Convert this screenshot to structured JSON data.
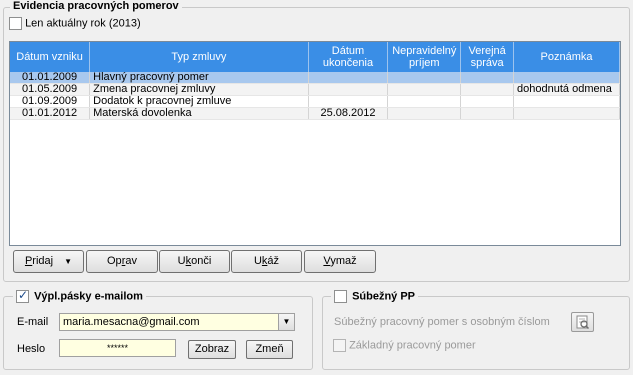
{
  "main_group": {
    "title": "Evidencia pracovných pomerov",
    "current_year_checkbox": {
      "label": "Len aktuálny rok (2013)",
      "checked": false
    }
  },
  "table": {
    "columns": [
      "Dátum vzniku",
      "Typ zmluvy",
      "Dátum ukončenia",
      "Nepravidelný príjem",
      "Verejná správa",
      "Poznámka"
    ],
    "rows": [
      [
        "01.01.2009",
        "Hlavný pracovný pomer",
        "",
        "",
        "",
        ""
      ],
      [
        "01.05.2009",
        "Zmena pracovnej zmluvy",
        "",
        "",
        "",
        "dohodnutá odmena"
      ],
      [
        "01.09.2009",
        "Dodatok k pracovnej zmluve",
        "",
        "",
        "",
        ""
      ],
      [
        "01.01.2012",
        "Materská dovolenka",
        "25.08.2012",
        "",
        "",
        ""
      ]
    ]
  },
  "buttons": {
    "add": {
      "pre": "",
      "key": "P",
      "post": "ridaj"
    },
    "edit": {
      "pre": "Op",
      "key": "r",
      "post": "av"
    },
    "finish": {
      "pre": "U",
      "key": "k",
      "post": "onči"
    },
    "show": {
      "pre": "U",
      "key": "k",
      "post": "áž"
    },
    "delete": {
      "pre": "",
      "key": "V",
      "post": "ymaž"
    },
    "dropdown_arrow": "▼"
  },
  "email_group": {
    "title": "Výpl.pásky e-mailom",
    "checked": true,
    "email_label": "E-mail",
    "email_value": "maria.mesacna@gmail.com",
    "password_label": "Heslo",
    "password_value": "******",
    "show_button": "Zobraz",
    "change_button": "Zmeň"
  },
  "parallel_group": {
    "title": "Súbežný PP",
    "checked": false,
    "personal_number_label": "Súbežný pracovný pomer s osobným číslom",
    "basic_employment_label": "Základný pracovný pomer",
    "basic_employment_checked": false
  },
  "colors": {
    "header_bg": "#3a8ee6",
    "selected_row": "#a8c8ee",
    "email_field_bg": "#ffffe1"
  }
}
